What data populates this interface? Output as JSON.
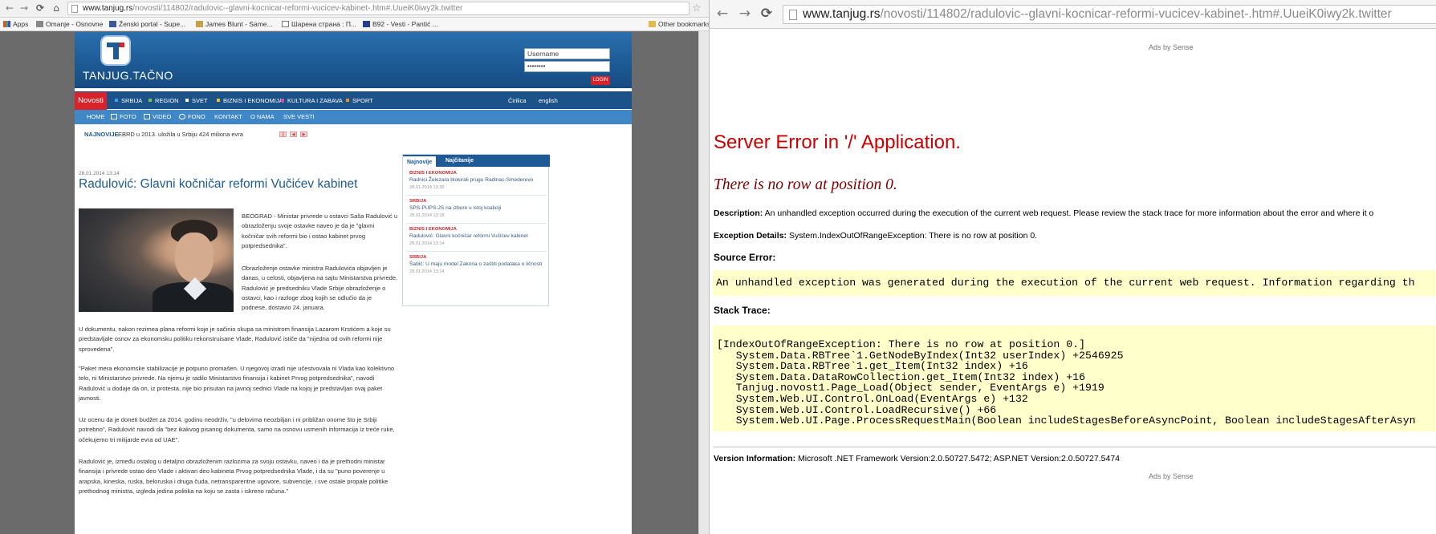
{
  "left_browser": {
    "url_domain": "www.tanjug.rs",
    "url_path": "/novosti/114802/radulovic--glavni-kocnicar-reformi-vucicev-kabinet-.htm#.UueiK0iwy2k.twitter",
    "bookmarks": [
      "Apps",
      "Omanje - Osnovne",
      "Ženski portal - Supe...",
      "James Blunt - Same...",
      "Шарена страна : П...",
      "B92 - Vesti - Pantić ..."
    ],
    "other_bookmarks": "Other bookmarks"
  },
  "tanjug": {
    "brand": "TANJUG.TAČNO",
    "username_value": "Username",
    "password_value": "••••••••",
    "login_label": "LOGIN",
    "menu": {
      "active": "Novosti",
      "items": [
        "SRBIJA",
        "REGION",
        "SVET",
        "BIZNIS I EKONOMIJA",
        "KULTURA I ZABAVA",
        "SPORT"
      ],
      "right_items": [
        "Ćirilica",
        "english"
      ],
      "colors": [
        "#3f9ee8",
        "#7fc242",
        "#ffffff",
        "#e9c32a",
        "#e14a9a",
        "#f28c1b"
      ]
    },
    "submenu": [
      "HOME",
      "FOTO",
      "VIDEO",
      "FONO",
      "KONTAKT",
      "O NAMA",
      "SVE VESTI"
    ],
    "ticker": {
      "label": "NAJNOVIJE",
      "text": "EBRD u 2013. uložila u Srbiju 424 miliona evra"
    },
    "article": {
      "date": "28.01.2014 13:14",
      "title": "Radulović: Glavni kočničar reformi Vučićev kabinet",
      "p1": "BEOGRAD - Ministar privrede u ostavci Saša Radulović u obrazloženju svoje ostavke naveo je da je \"glavni kočničar svih reformi bio i ostao kabinet prvog potpredsednika\".",
      "p2": "Obrazloženje ostavke ministra Radulovića objavljen je danas, u celosti, objavljena na sajtu Ministarstva privrede. Radulović je predsedniku Vlade Srbije obrazloženje o ostavci, kao i razloge zbog kojih se odlučio da je podnese, dostavio 24. januara.",
      "p3": "U dokumentu, nakon rezimea plana reformi koje je sačinio skupa sa ministrom finansija Lazarom Krstićem a koje su predstavljale osnov za ekonomsku politiku rekonstruisane Vlade, Radulović ističe da \"nijedna od ovih reformi nije sprovedena\".",
      "p4": "\"Paket mera ekonomske stabilizacije je potpuno promašen. U njegovoj izradi nije učestvovala ni Vlada kao kolektivno telo, ni Ministarstvo privrede. Na njemu je radilo Ministarstvo finansija i kabinet Prvog potpredsednika\", navodi Radulović u dodaje da on, iz protesta, nije bio prisutan na javnoj sednici Vlade na kojoj je predstavljan ovaj paket javnosti.",
      "p5": "Uz ocenu da je doneti budžet za 2014. godinu neodrživ, \"u delovima neozbiljan i ni približan onome što je Srbiji potrebno\", Radulović navodi da \"bez ikakvog pisanog dokumenta, samo na osnovu usmenih informacija iz treće ruke, očekujemo tri milijarde evra od UAE\".",
      "p6": "Radulović je, između ostalog u detaljno obrazloženim razlozima za svoju ostavku, naveo i da je prethodni ministar finansija i privrede ostao deo Vlade i aktivan deo kabineta Prvog potpredsednika Vlade, i da su \"puno poverenje u arapska, kineska, ruska, beloruska i druga čuda, netransparentne ugovore, subvencije, i sve ostale propale politike prethodnog ministra, izgleda jedina politika na koju se zasta i iskreno računa.\""
    },
    "sidebar": {
      "tab_latest": "Najnovije",
      "tab_read": "Najčitanije",
      "items": [
        {
          "category": "BIZNIS I EKONOMIJA",
          "text": "Radnici Železara blokirali prugu Radinac-Smederevo",
          "date": "28.01.2014 13:30"
        },
        {
          "category": "SRBIJA",
          "text": "SPS-PUPS-JS na izbore u istoj koaliciji",
          "date": "28.01.2014 13:18"
        },
        {
          "category": "BIZNIS I EKONOMIJA",
          "text": "Radulović: Glavni kočničar reformi Vučićev kabinet",
          "date": "28.01.2014 13:14"
        },
        {
          "category": "SRBIJA",
          "text": "Šabić: U maju model Zakona o zaštiti podataka o ličnosti",
          "date": "28.01.2014 13:14"
        }
      ]
    }
  },
  "right_browser": {
    "url_domain": "www.tanjug.rs",
    "url_path": "/novosti/114802/radulovic--glavni-kocnicar-reformi-vucicev-kabinet-.htm#.UueiK0iwy2k.twitter",
    "ads_label": "Ads by Sense",
    "error": {
      "title": "Server Error in '/' Application.",
      "message": "There is no row at position 0.",
      "description_label": "Description:",
      "description_text": "An unhandled exception occurred during the execution of the current web request. Please review the stack trace for more information about the error and where it o",
      "exception_label": "Exception Details:",
      "exception_text": "System.IndexOutOfRangeException: There is no row at position 0.",
      "source_label": "Source Error:",
      "source_text": "An unhandled exception was generated during the execution of the current web request. Information regarding th",
      "stack_label": "Stack Trace:",
      "stack_trace": "[IndexOutOfRangeException: There is no row at position 0.]\n   System.Data.RBTree`1.GetNodeByIndex(Int32 userIndex) +2546925\n   System.Data.RBTree`1.get_Item(Int32 index) +16\n   System.Data.DataRowCollection.get_Item(Int32 index) +16\n   Tanjug.novost1.Page_Load(Object sender, EventArgs e) +1919\n   System.Web.UI.Control.OnLoad(EventArgs e) +132\n   System.Web.UI.Control.LoadRecursive() +66\n   System.Web.UI.Page.ProcessRequestMain(Boolean includeStagesBeforeAsyncPoint, Boolean includeStagesAfterAsyn",
      "version_label": "Version Information:",
      "version_text": "Microsoft .NET Framework Version:2.0.50727.5472; ASP.NET Version:2.0.50727.5474"
    }
  }
}
